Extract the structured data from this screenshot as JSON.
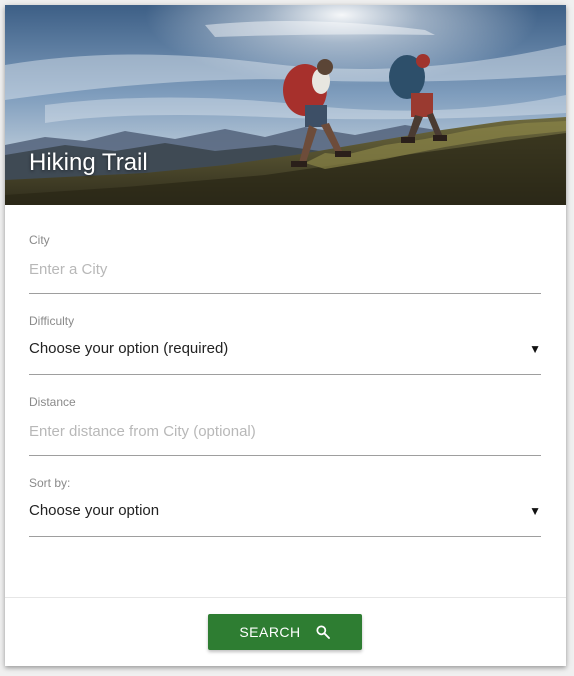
{
  "card": {
    "title": "Hiking Trail"
  },
  "form": {
    "city": {
      "label": "City",
      "placeholder": "Enter a City",
      "value": ""
    },
    "difficulty": {
      "label": "Difficulty",
      "selected": "Choose your option (required)",
      "caret": "▼"
    },
    "distance": {
      "label": "Distance",
      "placeholder": "Enter distance from City (optional)",
      "value": ""
    },
    "sort": {
      "label": "Sort by:",
      "selected": "Choose your option",
      "caret": "▼"
    }
  },
  "footer": {
    "search_label": "SEARCH",
    "search_icon": "search-icon"
  },
  "colors": {
    "accent": "#2e7d32",
    "underline": "#9e9e9e",
    "label": "#8a8a8a",
    "placeholder": "#b8b8b8"
  }
}
